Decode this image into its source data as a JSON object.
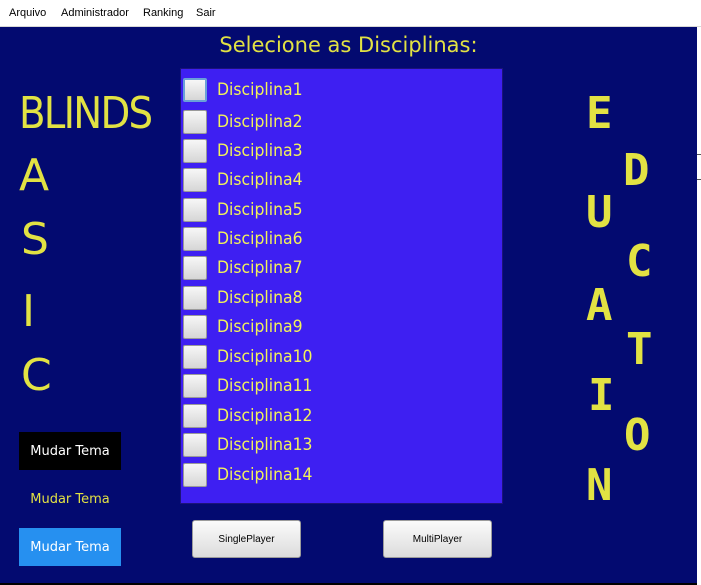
{
  "menu": [
    "Arquivo",
    "Administrador",
    "Ranking",
    "Sair"
  ],
  "title": "Selecione as Disciplinas:",
  "logo_left": {
    "word": "BLINDS",
    "letters": [
      "A",
      "S",
      "I",
      "C"
    ]
  },
  "logo_right": {
    "letters": [
      "E",
      "D",
      "U",
      "C",
      "A",
      "T",
      "I",
      "O",
      "N"
    ]
  },
  "disciplines": [
    {
      "label": "Disciplina1",
      "checked": false
    },
    {
      "label": "Disciplina2",
      "checked": false
    },
    {
      "label": "Disciplina3",
      "checked": false
    },
    {
      "label": "Disciplina4",
      "checked": false
    },
    {
      "label": "Disciplina5",
      "checked": false
    },
    {
      "label": "Disciplina6",
      "checked": false
    },
    {
      "label": "Disciplina7",
      "checked": false
    },
    {
      "label": "Disciplina8",
      "checked": false
    },
    {
      "label": "Disciplina9",
      "checked": false
    },
    {
      "label": "Disciplina10",
      "checked": false
    },
    {
      "label": "Disciplina11",
      "checked": false
    },
    {
      "label": "Disciplina12",
      "checked": false
    },
    {
      "label": "Disciplina13",
      "checked": false
    },
    {
      "label": "Disciplina14",
      "checked": false
    }
  ],
  "theme_buttons": [
    "Mudar Tema",
    "Mudar Tema",
    "Mudar Tema"
  ],
  "buttons": {
    "single": "SinglePlayer",
    "multi": "MultiPlayer"
  },
  "colors": {
    "background": "#030a70",
    "text_yellow": "#e2e243",
    "list_panel": "#3e1ff2",
    "theme_black": "#000000",
    "theme_blue": "#2690f0"
  }
}
